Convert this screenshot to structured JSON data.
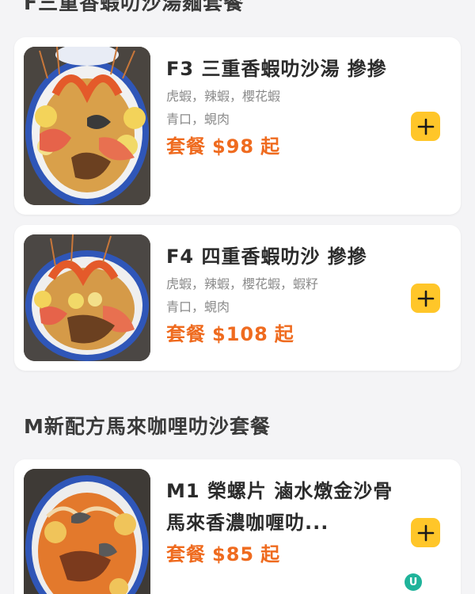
{
  "sections": {
    "top_title": "F三重香蝦叻沙湯麵套餐",
    "m_title": "M新配方馬來咖哩叻沙套餐"
  },
  "items": [
    {
      "name": "F3 三重香蝦叻沙湯 摻摻",
      "desc_line1": "虎蝦，辣蝦，櫻花蝦",
      "desc_line2": "青口，蜆肉",
      "price_label": "套餐",
      "price": "$98",
      "price_suffix": "起"
    },
    {
      "name": "F4 四重香蝦叻沙 摻摻",
      "desc_line1": "虎蝦，辣蝦，櫻花蝦，蝦籽",
      "desc_line2": "青口，蜆肉",
      "price_label": "套餐",
      "price": "$108",
      "price_suffix": "起"
    },
    {
      "name": "M1 榮螺片 滷水燉金沙骨 馬來香濃咖喱叻...",
      "price_label": "套餐",
      "price": "$85",
      "price_suffix": "起"
    }
  ],
  "icons": {
    "add": "plus-icon",
    "food_photo": "food-photo-icon"
  },
  "colors": {
    "background": "#f4f4f6",
    "accent_price": "#ef6b1f",
    "add_button": "#ffc629"
  }
}
